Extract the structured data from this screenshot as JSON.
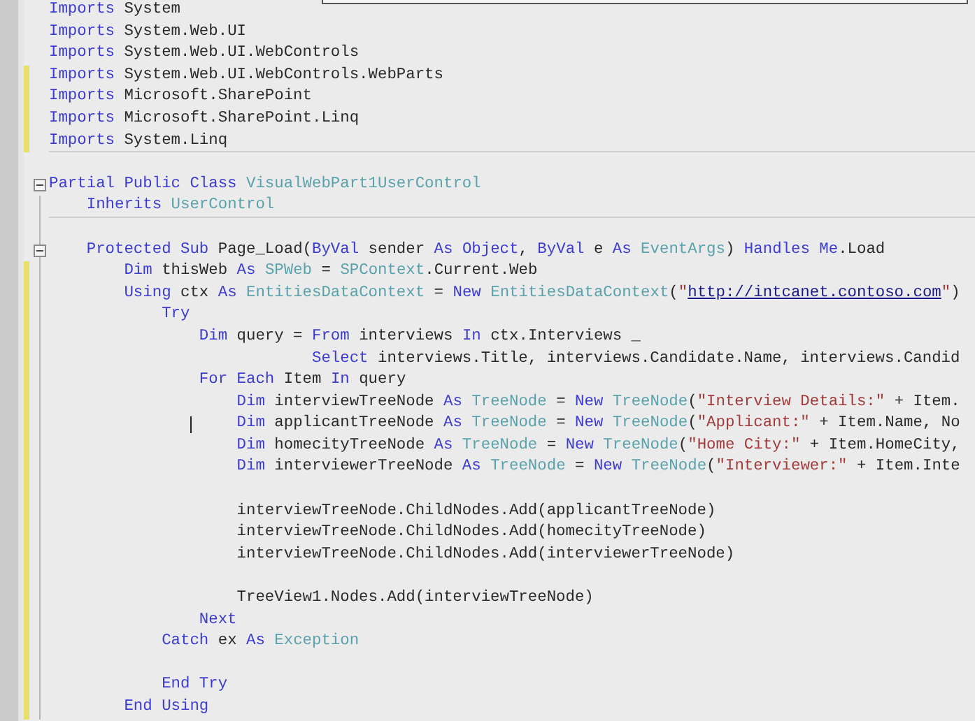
{
  "editor": {
    "lines": [
      {
        "changed": false,
        "fold": false,
        "cursor": false,
        "separator": false,
        "tokens": [
          {
            "kind": "keyword",
            "text": "Imports"
          },
          {
            "kind": "plain",
            "text": " System"
          }
        ]
      },
      {
        "changed": false,
        "fold": false,
        "cursor": false,
        "separator": false,
        "tokens": [
          {
            "kind": "keyword",
            "text": "Imports"
          },
          {
            "kind": "plain",
            "text": " System.Web.UI"
          }
        ]
      },
      {
        "changed": false,
        "fold": false,
        "cursor": false,
        "separator": false,
        "tokens": [
          {
            "kind": "keyword",
            "text": "Imports"
          },
          {
            "kind": "plain",
            "text": " System.Web.UI.WebControls"
          }
        ]
      },
      {
        "changed": true,
        "fold": false,
        "cursor": false,
        "separator": false,
        "tokens": [
          {
            "kind": "keyword",
            "text": "Imports"
          },
          {
            "kind": "plain",
            "text": " System.Web.UI.WebControls.WebParts"
          }
        ]
      },
      {
        "changed": true,
        "fold": false,
        "cursor": false,
        "separator": false,
        "tokens": [
          {
            "kind": "keyword",
            "text": "Imports"
          },
          {
            "kind": "plain",
            "text": " Microsoft.SharePoint"
          }
        ]
      },
      {
        "changed": true,
        "fold": false,
        "cursor": false,
        "separator": false,
        "tokens": [
          {
            "kind": "keyword",
            "text": "Imports"
          },
          {
            "kind": "plain",
            "text": " Microsoft.SharePoint.Linq"
          }
        ]
      },
      {
        "changed": true,
        "fold": false,
        "cursor": false,
        "separator": true,
        "tokens": [
          {
            "kind": "keyword",
            "text": "Imports"
          },
          {
            "kind": "plain",
            "text": " System.Linq"
          }
        ]
      },
      {
        "changed": false,
        "fold": false,
        "cursor": false,
        "separator": false
      },
      {
        "changed": false,
        "fold": true,
        "cursor": false,
        "separator": false,
        "tokens": [
          {
            "kind": "keyword",
            "text": "Partial Public Class"
          },
          {
            "kind": "type",
            "text": " VisualWebPart1UserControl"
          }
        ]
      },
      {
        "changed": false,
        "fold": false,
        "cursor": false,
        "separator": true,
        "tokens": [
          {
            "kind": "keyword",
            "text": "    Inherits"
          },
          {
            "kind": "type",
            "text": " UserControl"
          }
        ]
      },
      {
        "changed": false,
        "fold": false,
        "cursor": false,
        "separator": false
      },
      {
        "changed": false,
        "fold": true,
        "cursor": false,
        "separator": false,
        "tokens": [
          {
            "kind": "keyword",
            "text": "    Protected Sub"
          },
          {
            "kind": "plain",
            "text": " Page_Load("
          },
          {
            "kind": "keyword",
            "text": "ByVal"
          },
          {
            "kind": "plain",
            "text": " sender "
          },
          {
            "kind": "keyword",
            "text": "As Object"
          },
          {
            "kind": "plain",
            "text": ", "
          },
          {
            "kind": "keyword",
            "text": "ByVal"
          },
          {
            "kind": "plain",
            "text": " e "
          },
          {
            "kind": "keyword",
            "text": "As"
          },
          {
            "kind": "type",
            "text": " EventArgs"
          },
          {
            "kind": "plain",
            "text": ") "
          },
          {
            "kind": "keyword",
            "text": "Handles Me"
          },
          {
            "kind": "plain",
            "text": ".Load"
          }
        ]
      },
      {
        "changed": true,
        "fold": false,
        "cursor": false,
        "separator": false,
        "tokens": [
          {
            "kind": "keyword",
            "text": "        Dim"
          },
          {
            "kind": "plain",
            "text": " thisWeb "
          },
          {
            "kind": "keyword",
            "text": "As"
          },
          {
            "kind": "type",
            "text": " SPWeb"
          },
          {
            "kind": "plain",
            "text": " = "
          },
          {
            "kind": "type",
            "text": "SPContext"
          },
          {
            "kind": "plain",
            "text": ".Current.Web"
          }
        ]
      },
      {
        "changed": true,
        "fold": false,
        "cursor": false,
        "separator": false,
        "tokens": [
          {
            "kind": "keyword",
            "text": "        Using"
          },
          {
            "kind": "plain",
            "text": " ctx "
          },
          {
            "kind": "keyword",
            "text": "As"
          },
          {
            "kind": "type",
            "text": " EntitiesDataContext"
          },
          {
            "kind": "plain",
            "text": " = "
          },
          {
            "kind": "keyword",
            "text": "New"
          },
          {
            "kind": "type",
            "text": " EntitiesDataContext"
          },
          {
            "kind": "plain",
            "text": "("
          },
          {
            "kind": "string",
            "text": "\""
          },
          {
            "kind": "link",
            "text": "http://intcanet.contoso.com"
          },
          {
            "kind": "string",
            "text": "\""
          },
          {
            "kind": "plain",
            "text": ")"
          }
        ]
      },
      {
        "changed": true,
        "fold": false,
        "cursor": false,
        "separator": false,
        "tokens": [
          {
            "kind": "keyword",
            "text": "            Try"
          }
        ]
      },
      {
        "changed": true,
        "fold": false,
        "cursor": false,
        "separator": false,
        "tokens": [
          {
            "kind": "keyword",
            "text": "                Dim"
          },
          {
            "kind": "plain",
            "text": " query = "
          },
          {
            "kind": "keyword",
            "text": "From"
          },
          {
            "kind": "plain",
            "text": " interviews "
          },
          {
            "kind": "keyword",
            "text": "In"
          },
          {
            "kind": "plain",
            "text": " ctx.Interviews _"
          }
        ]
      },
      {
        "changed": true,
        "fold": false,
        "cursor": false,
        "separator": false,
        "tokens": [
          {
            "kind": "keyword",
            "text": "                            Select"
          },
          {
            "kind": "plain",
            "text": " interviews.Title, interviews.Candidate.Name, interviews.Candid"
          }
        ]
      },
      {
        "changed": true,
        "fold": false,
        "cursor": false,
        "separator": false,
        "tokens": [
          {
            "kind": "keyword",
            "text": "                For Each"
          },
          {
            "kind": "plain",
            "text": " Item "
          },
          {
            "kind": "keyword",
            "text": "In"
          },
          {
            "kind": "plain",
            "text": " query"
          }
        ]
      },
      {
        "changed": true,
        "fold": false,
        "cursor": false,
        "separator": false,
        "tokens": [
          {
            "kind": "keyword",
            "text": "                    Dim"
          },
          {
            "kind": "plain",
            "text": " interviewTreeNode "
          },
          {
            "kind": "keyword",
            "text": "As"
          },
          {
            "kind": "type",
            "text": " TreeNode"
          },
          {
            "kind": "plain",
            "text": " = "
          },
          {
            "kind": "keyword",
            "text": "New"
          },
          {
            "kind": "type",
            "text": " TreeNode"
          },
          {
            "kind": "plain",
            "text": "("
          },
          {
            "kind": "string",
            "text": "\"Interview Details:\""
          },
          {
            "kind": "plain",
            "text": " + Item."
          }
        ]
      },
      {
        "changed": true,
        "fold": false,
        "cursor": true,
        "separator": false,
        "tokens": [
          {
            "kind": "keyword",
            "text": "                    Dim"
          },
          {
            "kind": "plain",
            "text": " applicantTreeNode "
          },
          {
            "kind": "keyword",
            "text": "As"
          },
          {
            "kind": "type",
            "text": " TreeNode"
          },
          {
            "kind": "plain",
            "text": " = "
          },
          {
            "kind": "keyword",
            "text": "New"
          },
          {
            "kind": "type",
            "text": " TreeNode"
          },
          {
            "kind": "plain",
            "text": "("
          },
          {
            "kind": "string",
            "text": "\"Applicant:\""
          },
          {
            "kind": "plain",
            "text": " + Item.Name, No"
          }
        ]
      },
      {
        "changed": true,
        "fold": false,
        "cursor": false,
        "separator": false,
        "tokens": [
          {
            "kind": "keyword",
            "text": "                    Dim"
          },
          {
            "kind": "plain",
            "text": " homecityTreeNode "
          },
          {
            "kind": "keyword",
            "text": "As"
          },
          {
            "kind": "type",
            "text": " TreeNode"
          },
          {
            "kind": "plain",
            "text": " = "
          },
          {
            "kind": "keyword",
            "text": "New"
          },
          {
            "kind": "type",
            "text": " TreeNode"
          },
          {
            "kind": "plain",
            "text": "("
          },
          {
            "kind": "string",
            "text": "\"Home City:\""
          },
          {
            "kind": "plain",
            "text": " + Item.HomeCity,"
          }
        ]
      },
      {
        "changed": true,
        "fold": false,
        "cursor": false,
        "separator": false,
        "tokens": [
          {
            "kind": "keyword",
            "text": "                    Dim"
          },
          {
            "kind": "plain",
            "text": " interviewerTreeNode "
          },
          {
            "kind": "keyword",
            "text": "As"
          },
          {
            "kind": "type",
            "text": " TreeNode"
          },
          {
            "kind": "plain",
            "text": " = "
          },
          {
            "kind": "keyword",
            "text": "New"
          },
          {
            "kind": "type",
            "text": " TreeNode"
          },
          {
            "kind": "plain",
            "text": "("
          },
          {
            "kind": "string",
            "text": "\"Interviewer:\""
          },
          {
            "kind": "plain",
            "text": " + Item.Inte"
          }
        ]
      },
      {
        "changed": true,
        "fold": false,
        "cursor": false,
        "separator": false
      },
      {
        "changed": true,
        "fold": false,
        "cursor": false,
        "separator": false,
        "tokens": [
          {
            "kind": "plain",
            "text": "                    interviewTreeNode.ChildNodes.Add(applicantTreeNode)"
          }
        ]
      },
      {
        "changed": true,
        "fold": false,
        "cursor": false,
        "separator": false,
        "tokens": [
          {
            "kind": "plain",
            "text": "                    interviewTreeNode.ChildNodes.Add(homecityTreeNode)"
          }
        ]
      },
      {
        "changed": true,
        "fold": false,
        "cursor": false,
        "separator": false,
        "tokens": [
          {
            "kind": "plain",
            "text": "                    interviewTreeNode.ChildNodes.Add(interviewerTreeNode)"
          }
        ]
      },
      {
        "changed": true,
        "fold": false,
        "cursor": false,
        "separator": false
      },
      {
        "changed": true,
        "fold": false,
        "cursor": false,
        "separator": false,
        "tokens": [
          {
            "kind": "plain",
            "text": "                    TreeView1.Nodes.Add(interviewTreeNode)"
          }
        ]
      },
      {
        "changed": true,
        "fold": false,
        "cursor": false,
        "separator": false,
        "tokens": [
          {
            "kind": "keyword",
            "text": "                Next"
          }
        ]
      },
      {
        "changed": true,
        "fold": false,
        "cursor": false,
        "separator": false,
        "tokens": [
          {
            "kind": "keyword",
            "text": "            Catch"
          },
          {
            "kind": "plain",
            "text": " ex "
          },
          {
            "kind": "keyword",
            "text": "As"
          },
          {
            "kind": "type",
            "text": " Exception"
          }
        ]
      },
      {
        "changed": true,
        "fold": false,
        "cursor": false,
        "separator": false
      },
      {
        "changed": true,
        "fold": false,
        "cursor": false,
        "separator": false,
        "tokens": [
          {
            "kind": "keyword",
            "text": "            End Try"
          }
        ]
      },
      {
        "changed": true,
        "fold": false,
        "cursor": false,
        "separator": false,
        "tokens": [
          {
            "kind": "keyword",
            "text": "        End Using"
          }
        ]
      }
    ]
  }
}
